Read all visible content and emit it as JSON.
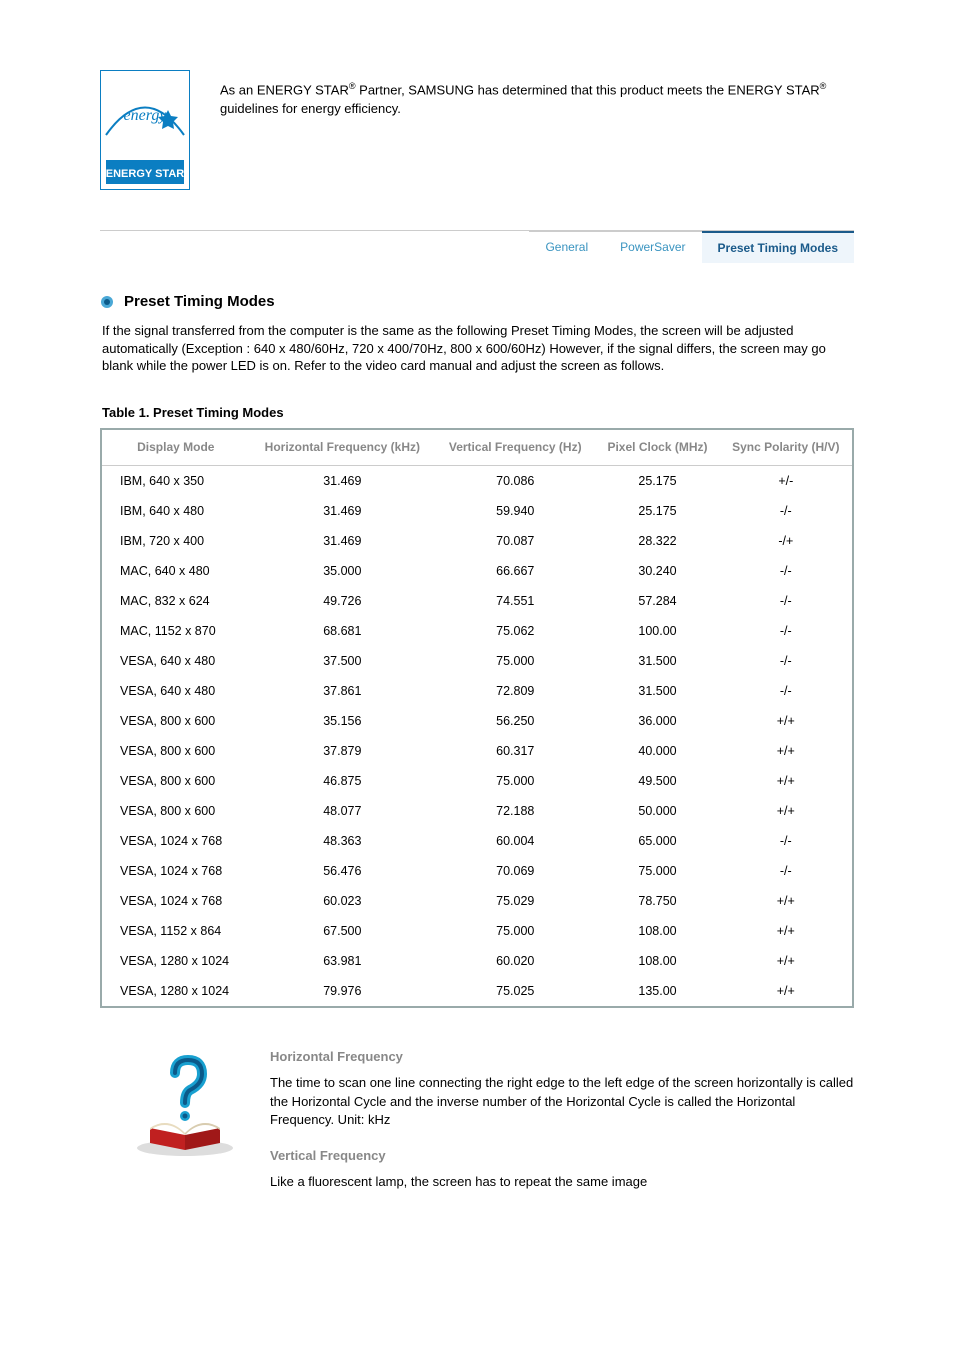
{
  "top": {
    "text_before_sup1": "As an ENERGY STAR",
    "sup1": "®",
    "text_mid": " Partner, SAMSUNG has determined that this product meets the ENERGY STAR",
    "sup2": "®",
    "text_after": " guidelines for energy efficiency."
  },
  "tabs": {
    "general": "General",
    "powersaver": "PowerSaver",
    "preset": "Preset Timing Modes"
  },
  "section": {
    "title": "Preset Timing Modes",
    "intro": "If the signal transferred from the computer is the same as the following Preset Timing Modes, the screen will be adjusted automatically (Exception : 640 x 480/60Hz, 720 x 400/70Hz, 800 x 600/60Hz) However, if the signal differs, the screen may go blank while the power LED is on. Refer to the video card manual and adjust the screen as follows.",
    "table_caption": "Table 1. Preset Timing Modes"
  },
  "table": {
    "headers": {
      "mode": "Display Mode",
      "hfreq": "Horizontal Frequency (kHz)",
      "vfreq": "Vertical Frequency (Hz)",
      "pixel": "Pixel Clock (MHz)",
      "sync": "Sync Polarity (H/V)"
    },
    "rows": [
      {
        "mode": "IBM, 640 x 350",
        "hf": "31.469",
        "vf": "70.086",
        "px": "25.175",
        "sp": "+/-"
      },
      {
        "mode": "IBM, 640 x 480",
        "hf": "31.469",
        "vf": "59.940",
        "px": "25.175",
        "sp": "-/-"
      },
      {
        "mode": "IBM, 720 x 400",
        "hf": "31.469",
        "vf": "70.087",
        "px": "28.322",
        "sp": "-/+"
      },
      {
        "mode": "MAC, 640 x 480",
        "hf": "35.000",
        "vf": "66.667",
        "px": "30.240",
        "sp": "-/-"
      },
      {
        "mode": "MAC, 832 x 624",
        "hf": "49.726",
        "vf": "74.551",
        "px": "57.284",
        "sp": "-/-"
      },
      {
        "mode": "MAC, 1152 x 870",
        "hf": "68.681",
        "vf": "75.062",
        "px": "100.00",
        "sp": "-/-"
      },
      {
        "mode": "VESA, 640 x 480",
        "hf": "37.500",
        "vf": "75.000",
        "px": "31.500",
        "sp": "-/-"
      },
      {
        "mode": "VESA, 640 x 480",
        "hf": "37.861",
        "vf": "72.809",
        "px": "31.500",
        "sp": "-/-"
      },
      {
        "mode": "VESA, 800 x 600",
        "hf": "35.156",
        "vf": "56.250",
        "px": "36.000",
        "sp": "+/+"
      },
      {
        "mode": "VESA, 800 x 600",
        "hf": "37.879",
        "vf": "60.317",
        "px": "40.000",
        "sp": "+/+"
      },
      {
        "mode": "VESA, 800 x 600",
        "hf": "46.875",
        "vf": "75.000",
        "px": "49.500",
        "sp": "+/+"
      },
      {
        "mode": "VESA, 800 x 600",
        "hf": "48.077",
        "vf": "72.188",
        "px": "50.000",
        "sp": "+/+"
      },
      {
        "mode": "VESA, 1024 x 768",
        "hf": "48.363",
        "vf": "60.004",
        "px": "65.000",
        "sp": "-/-"
      },
      {
        "mode": "VESA, 1024 x 768",
        "hf": "56.476",
        "vf": "70.069",
        "px": "75.000",
        "sp": "-/-"
      },
      {
        "mode": "VESA, 1024 x 768",
        "hf": "60.023",
        "vf": "75.029",
        "px": "78.750",
        "sp": "+/+"
      },
      {
        "mode": "VESA, 1152 x 864",
        "hf": "67.500",
        "vf": "75.000",
        "px": "108.00",
        "sp": "+/+"
      },
      {
        "mode": "VESA, 1280 x 1024",
        "hf": "63.981",
        "vf": "60.020",
        "px": "108.00",
        "sp": "+/+"
      },
      {
        "mode": "VESA, 1280 x 1024",
        "hf": "79.976",
        "vf": "75.025",
        "px": "135.00",
        "sp": "+/+"
      }
    ]
  },
  "defs": {
    "hf_title": "Horizontal Frequency",
    "hf_body": "The time to scan one line connecting the right edge to the left edge of the screen horizontally is called the Horizontal Cycle and the inverse number of the Horizontal Cycle is called the Horizontal Frequency. Unit: kHz",
    "vf_title": "Vertical Frequency",
    "vf_body": "Like a fluorescent lamp, the screen has to repeat the same image"
  }
}
